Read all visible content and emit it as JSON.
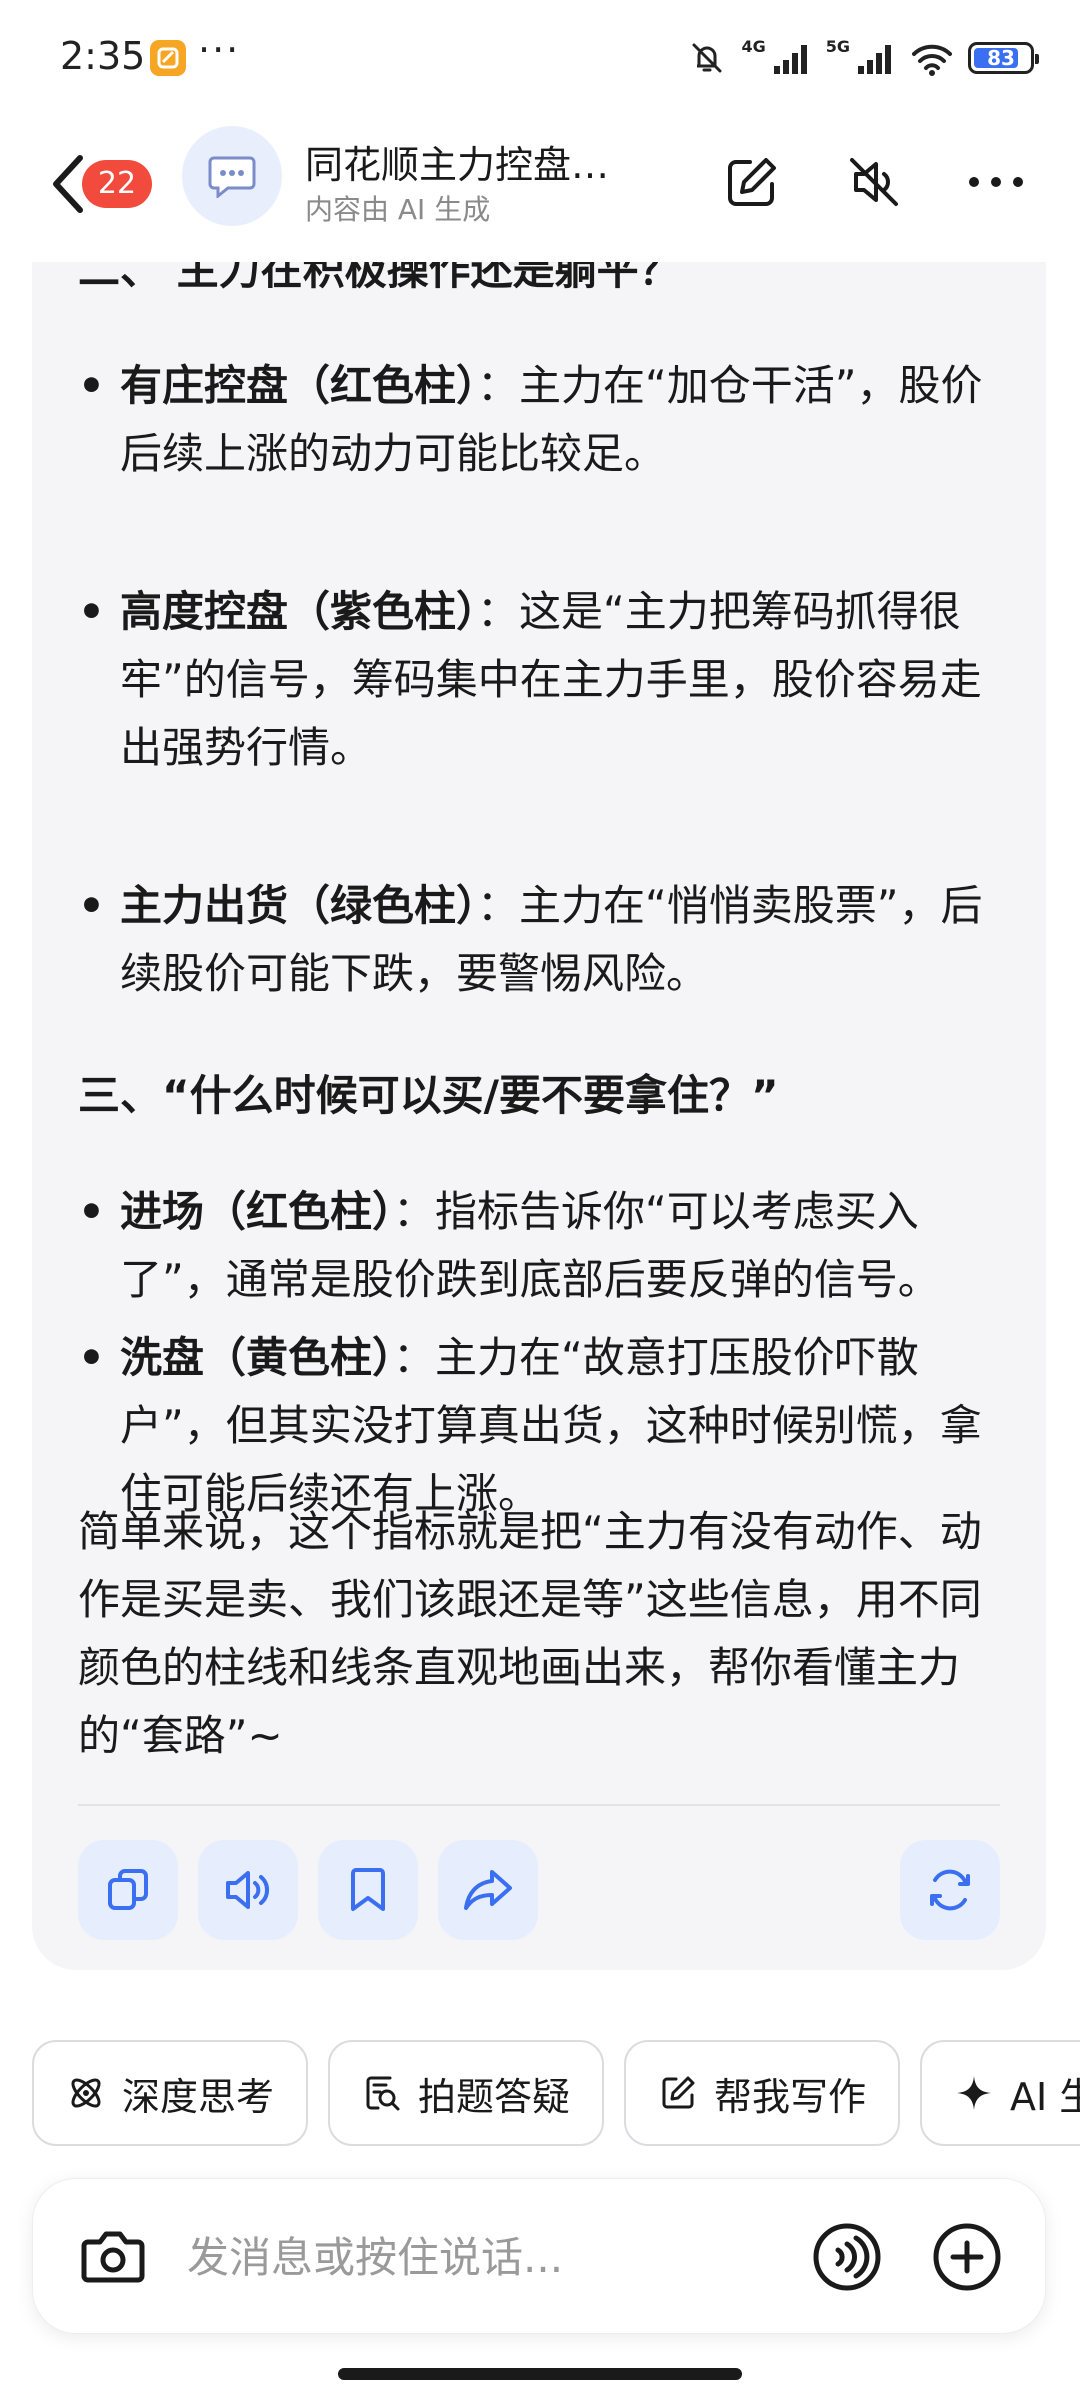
{
  "status": {
    "time": "2:35",
    "more": "···",
    "signal_1": "4G",
    "signal_2": "5G",
    "battery": 83
  },
  "header": {
    "badge_count": "22",
    "title": "同花顺主力控盘…",
    "subtitle": "内容由 AI 生成"
  },
  "message": {
    "clipped_heading": "二、 主力在积极操作还是躺平？",
    "bullets_a": [
      {
        "term": "有庄控盘（红色柱）",
        "text": "：主力在“加仓干活”，股价后续上涨的动力可能比较足。"
      },
      {
        "term": "高度控盘（紫色柱）",
        "text": "：这是“主力把筹码抓得很牢”的信号，筹码集中在主力手里，股价容易走出强势行情。"
      },
      {
        "term": "主力出货（绿色柱）",
        "text": "：主力在“悄悄卖股票”，后续股价可能下跌，要警惕风险。"
      }
    ],
    "section_3_heading": "三、“什么时候可以买/要不要拿住？”",
    "bullets_b": [
      {
        "term": "进场（红色柱）",
        "text": "：指标告诉你“可以考虑买入了”，通常是股价跌到底部后要反弹的信号。"
      },
      {
        "term": "洗盘（黄色柱）",
        "text": "：主力在“故意打压股价吓散户”，但其实没打算真出货，这种时候别慌，拿住可能后续还有上涨。"
      }
    ],
    "summary": "简单来说，这个指标就是把“主力有没有动作、动作是买是卖、我们该跟还是等”这些信息，用不同颜色的柱线和线条直观地画出来，帮你看懂主力的“套路”~"
  },
  "actions": [
    "copy-icon",
    "speaker-icon",
    "bookmark-icon",
    "share-icon",
    "refresh-icon"
  ],
  "chips": [
    {
      "label": "深度思考",
      "icon": "atom-icon"
    },
    {
      "label": "拍题答疑",
      "icon": "photo-search-icon"
    },
    {
      "label": "帮我写作",
      "icon": "edit-icon"
    },
    {
      "label": "AI 生",
      "icon": "sparkle-icon"
    }
  ],
  "input": {
    "placeholder": "发消息或按住说话..."
  },
  "colors": {
    "accent": "#3a6ff2",
    "badge": "#f24a3c",
    "card_bg": "#f5f5f7",
    "action_bg": "#e6edfc"
  }
}
